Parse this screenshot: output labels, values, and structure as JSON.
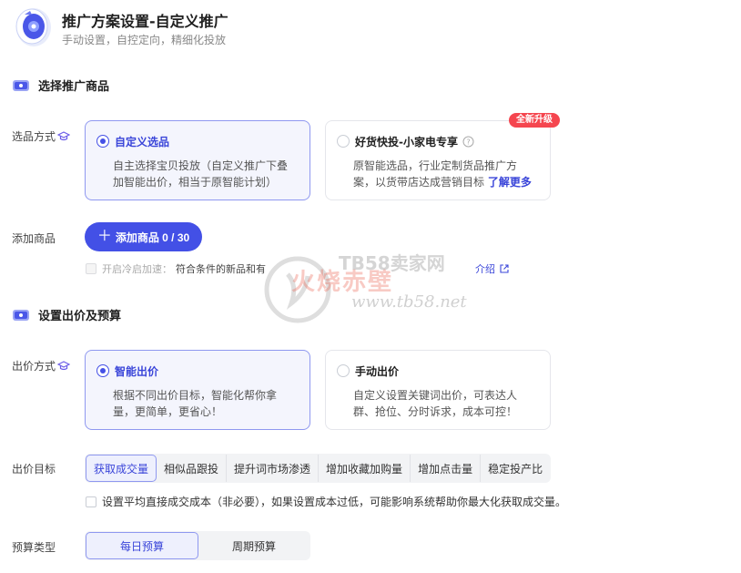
{
  "header": {
    "title": "推广方案设置-自定义推广",
    "subtitle": "手动设置，自控定向，精细化投放"
  },
  "section_product": {
    "title": "选择推广商品"
  },
  "select_mode": {
    "label": "选品方式",
    "options": [
      {
        "title": "自定义选品",
        "desc": "自主选择宝贝投放（自定义推广下叠加智能出价，相当于原智能计划）",
        "selected": true
      },
      {
        "title": "好货快投-小家电专享",
        "desc": "原智能选品，行业定制货品推广方案，以货带店达成营销目标",
        "link": "了解更多",
        "badge": "全新升级",
        "selected": false
      }
    ]
  },
  "add_product": {
    "label": "添加商品",
    "button": "添加商品 0 / 30",
    "coldstart_label": "开启冷启加速：",
    "coldstart_desc": "符合条件的新品和有",
    "coldstart_link": "介绍"
  },
  "section_bid": {
    "title": "设置出价及预算"
  },
  "bid_mode": {
    "label": "出价方式",
    "options": [
      {
        "title": "智能出价",
        "desc": "根据不同出价目标，智能化帮你拿量，更简单，更省心！",
        "selected": true
      },
      {
        "title": "手动出价",
        "desc": "自定义设置关键词出价，可表达人群、抢位、分时诉求，成本可控！",
        "selected": false
      }
    ]
  },
  "bid_goal": {
    "label": "出价目标",
    "tabs": [
      "获取成交量",
      "相似品跟投",
      "提升词市场渗透",
      "增加收藏加购量",
      "增加点击量",
      "稳定投产比"
    ],
    "active_index": 0,
    "cost_text": "设置平均直接成交成本（非必要），如果设置成本过低，可能影响系统帮助你最大化获取成交量。"
  },
  "budget": {
    "label": "预算类型",
    "options": [
      "每日预算",
      "周期预算"
    ],
    "active_index": 0
  },
  "watermark": {
    "cn": "火烧赤壁",
    "site": "TB58卖家网",
    "url": "www.tb58.net"
  },
  "colors": {
    "accent": "#4350e6",
    "badge": "#f5464f",
    "selected_border": "#8f98f0",
    "selected_bg": "#f4f5fd"
  },
  "icons": [
    "logo-disc-icon",
    "section-ticket-icon",
    "graduation-cap-icon",
    "help-circle-icon",
    "plus-icon",
    "external-link-icon"
  ]
}
